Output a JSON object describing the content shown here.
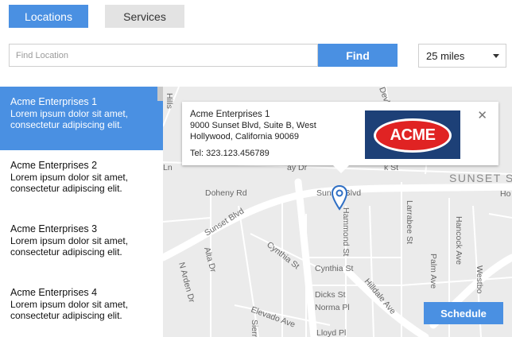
{
  "tabs": {
    "locations_label": "Locations",
    "services_label": "Services"
  },
  "search": {
    "placeholder": "Find Location",
    "value": "",
    "find_label": "Find",
    "distance_selected": "25 miles"
  },
  "locations": [
    {
      "name": "Acme Enterprises 1",
      "desc": "Lorem ipsum dolor sit amet, consectetur adipiscing elit."
    },
    {
      "name": "Acme Enterprises 2",
      "desc": "Lorem ipsum dolor sit amet, consectetur adipiscing elit."
    },
    {
      "name": "Acme Enterprises 3",
      "desc": "Lorem ipsum dolor sit amet, consectetur adipiscing elit."
    },
    {
      "name": "Acme Enterprises 4",
      "desc": "Lorem ipsum dolor sit amet, consectetur adipiscing elit."
    }
  ],
  "info_window": {
    "name": "Acme Enterprises 1",
    "address_line1": "9000 Sunset Blvd, Suite B, West",
    "address_line2": "Hollywood, California 90069",
    "phone": "Tel: 323.123.456789",
    "logo_text": "ACME",
    "close_symbol": "✕"
  },
  "map_labels": {
    "doheny": "Doheny Rd",
    "sunset_blvd_left": "Sunset Blvd",
    "sunset_blvd_center": "Sunset Blvd",
    "sunset_district": "SUNSET S",
    "ho": "Ho",
    "ln": "Ln",
    "ay_dr": "ay Dr",
    "k_st": "k St",
    "cynthia_st_diag": "Cynthia St",
    "cynthia_st": "Cynthia St",
    "dicks_st": "Dicks St",
    "norma_pl": "Norma Pl",
    "elevado": "Elevado Ave",
    "lloyd": "Lloyd Pl",
    "hammond": "Hammond St",
    "larrabee": "Larrabee St",
    "hancock": "Hancock Ave",
    "palm": "Palm Ave",
    "westbo": "Westbo",
    "hilldale": "Hilldale Ave",
    "n_arden": "N Arden Dr",
    "alta": "Alta Dr",
    "hills": "Hills",
    "devlin": "Devlin",
    "sierra": "Sierra"
  },
  "schedule_label": "Schedule",
  "colors": {
    "accent": "#4a90e2",
    "tab_inactive": "#e3e3e3",
    "map_bg": "#ebebeb",
    "map_road": "#ffffff",
    "acme_blue": "#1d4077",
    "acme_red": "#e02323"
  }
}
